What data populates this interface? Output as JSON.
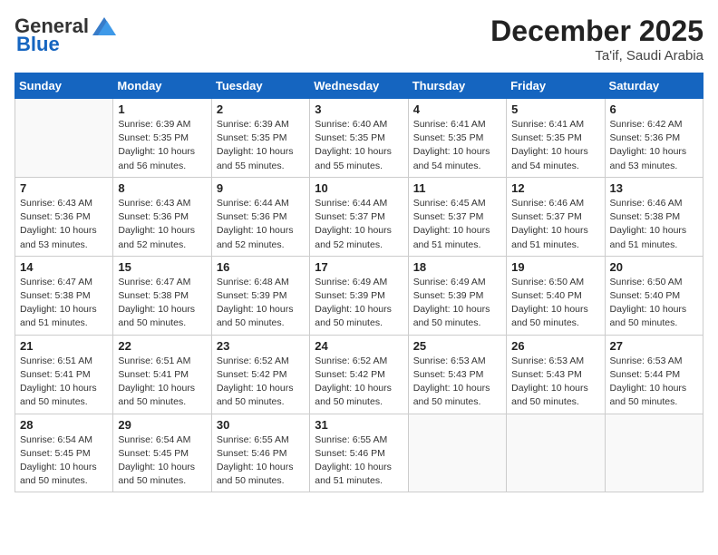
{
  "header": {
    "logo_general": "General",
    "logo_blue": "Blue",
    "month": "December 2025",
    "location": "Ta'if, Saudi Arabia"
  },
  "days_of_week": [
    "Sunday",
    "Monday",
    "Tuesday",
    "Wednesday",
    "Thursday",
    "Friday",
    "Saturday"
  ],
  "weeks": [
    [
      {
        "day": "",
        "sunrise": "",
        "sunset": "",
        "daylight": ""
      },
      {
        "day": "1",
        "sunrise": "Sunrise: 6:39 AM",
        "sunset": "Sunset: 5:35 PM",
        "daylight": "Daylight: 10 hours and 56 minutes."
      },
      {
        "day": "2",
        "sunrise": "Sunrise: 6:39 AM",
        "sunset": "Sunset: 5:35 PM",
        "daylight": "Daylight: 10 hours and 55 minutes."
      },
      {
        "day": "3",
        "sunrise": "Sunrise: 6:40 AM",
        "sunset": "Sunset: 5:35 PM",
        "daylight": "Daylight: 10 hours and 55 minutes."
      },
      {
        "day": "4",
        "sunrise": "Sunrise: 6:41 AM",
        "sunset": "Sunset: 5:35 PM",
        "daylight": "Daylight: 10 hours and 54 minutes."
      },
      {
        "day": "5",
        "sunrise": "Sunrise: 6:41 AM",
        "sunset": "Sunset: 5:35 PM",
        "daylight": "Daylight: 10 hours and 54 minutes."
      },
      {
        "day": "6",
        "sunrise": "Sunrise: 6:42 AM",
        "sunset": "Sunset: 5:36 PM",
        "daylight": "Daylight: 10 hours and 53 minutes."
      }
    ],
    [
      {
        "day": "7",
        "sunrise": "Sunrise: 6:43 AM",
        "sunset": "Sunset: 5:36 PM",
        "daylight": "Daylight: 10 hours and 53 minutes."
      },
      {
        "day": "8",
        "sunrise": "Sunrise: 6:43 AM",
        "sunset": "Sunset: 5:36 PM",
        "daylight": "Daylight: 10 hours and 52 minutes."
      },
      {
        "day": "9",
        "sunrise": "Sunrise: 6:44 AM",
        "sunset": "Sunset: 5:36 PM",
        "daylight": "Daylight: 10 hours and 52 minutes."
      },
      {
        "day": "10",
        "sunrise": "Sunrise: 6:44 AM",
        "sunset": "Sunset: 5:37 PM",
        "daylight": "Daylight: 10 hours and 52 minutes."
      },
      {
        "day": "11",
        "sunrise": "Sunrise: 6:45 AM",
        "sunset": "Sunset: 5:37 PM",
        "daylight": "Daylight: 10 hours and 51 minutes."
      },
      {
        "day": "12",
        "sunrise": "Sunrise: 6:46 AM",
        "sunset": "Sunset: 5:37 PM",
        "daylight": "Daylight: 10 hours and 51 minutes."
      },
      {
        "day": "13",
        "sunrise": "Sunrise: 6:46 AM",
        "sunset": "Sunset: 5:38 PM",
        "daylight": "Daylight: 10 hours and 51 minutes."
      }
    ],
    [
      {
        "day": "14",
        "sunrise": "Sunrise: 6:47 AM",
        "sunset": "Sunset: 5:38 PM",
        "daylight": "Daylight: 10 hours and 51 minutes."
      },
      {
        "day": "15",
        "sunrise": "Sunrise: 6:47 AM",
        "sunset": "Sunset: 5:38 PM",
        "daylight": "Daylight: 10 hours and 50 minutes."
      },
      {
        "day": "16",
        "sunrise": "Sunrise: 6:48 AM",
        "sunset": "Sunset: 5:39 PM",
        "daylight": "Daylight: 10 hours and 50 minutes."
      },
      {
        "day": "17",
        "sunrise": "Sunrise: 6:49 AM",
        "sunset": "Sunset: 5:39 PM",
        "daylight": "Daylight: 10 hours and 50 minutes."
      },
      {
        "day": "18",
        "sunrise": "Sunrise: 6:49 AM",
        "sunset": "Sunset: 5:39 PM",
        "daylight": "Daylight: 10 hours and 50 minutes."
      },
      {
        "day": "19",
        "sunrise": "Sunrise: 6:50 AM",
        "sunset": "Sunset: 5:40 PM",
        "daylight": "Daylight: 10 hours and 50 minutes."
      },
      {
        "day": "20",
        "sunrise": "Sunrise: 6:50 AM",
        "sunset": "Sunset: 5:40 PM",
        "daylight": "Daylight: 10 hours and 50 minutes."
      }
    ],
    [
      {
        "day": "21",
        "sunrise": "Sunrise: 6:51 AM",
        "sunset": "Sunset: 5:41 PM",
        "daylight": "Daylight: 10 hours and 50 minutes."
      },
      {
        "day": "22",
        "sunrise": "Sunrise: 6:51 AM",
        "sunset": "Sunset: 5:41 PM",
        "daylight": "Daylight: 10 hours and 50 minutes."
      },
      {
        "day": "23",
        "sunrise": "Sunrise: 6:52 AM",
        "sunset": "Sunset: 5:42 PM",
        "daylight": "Daylight: 10 hours and 50 minutes."
      },
      {
        "day": "24",
        "sunrise": "Sunrise: 6:52 AM",
        "sunset": "Sunset: 5:42 PM",
        "daylight": "Daylight: 10 hours and 50 minutes."
      },
      {
        "day": "25",
        "sunrise": "Sunrise: 6:53 AM",
        "sunset": "Sunset: 5:43 PM",
        "daylight": "Daylight: 10 hours and 50 minutes."
      },
      {
        "day": "26",
        "sunrise": "Sunrise: 6:53 AM",
        "sunset": "Sunset: 5:43 PM",
        "daylight": "Daylight: 10 hours and 50 minutes."
      },
      {
        "day": "27",
        "sunrise": "Sunrise: 6:53 AM",
        "sunset": "Sunset: 5:44 PM",
        "daylight": "Daylight: 10 hours and 50 minutes."
      }
    ],
    [
      {
        "day": "28",
        "sunrise": "Sunrise: 6:54 AM",
        "sunset": "Sunset: 5:45 PM",
        "daylight": "Daylight: 10 hours and 50 minutes."
      },
      {
        "day": "29",
        "sunrise": "Sunrise: 6:54 AM",
        "sunset": "Sunset: 5:45 PM",
        "daylight": "Daylight: 10 hours and 50 minutes."
      },
      {
        "day": "30",
        "sunrise": "Sunrise: 6:55 AM",
        "sunset": "Sunset: 5:46 PM",
        "daylight": "Daylight: 10 hours and 50 minutes."
      },
      {
        "day": "31",
        "sunrise": "Sunrise: 6:55 AM",
        "sunset": "Sunset: 5:46 PM",
        "daylight": "Daylight: 10 hours and 51 minutes."
      },
      {
        "day": "",
        "sunrise": "",
        "sunset": "",
        "daylight": ""
      },
      {
        "day": "",
        "sunrise": "",
        "sunset": "",
        "daylight": ""
      },
      {
        "day": "",
        "sunrise": "",
        "sunset": "",
        "daylight": ""
      }
    ]
  ]
}
